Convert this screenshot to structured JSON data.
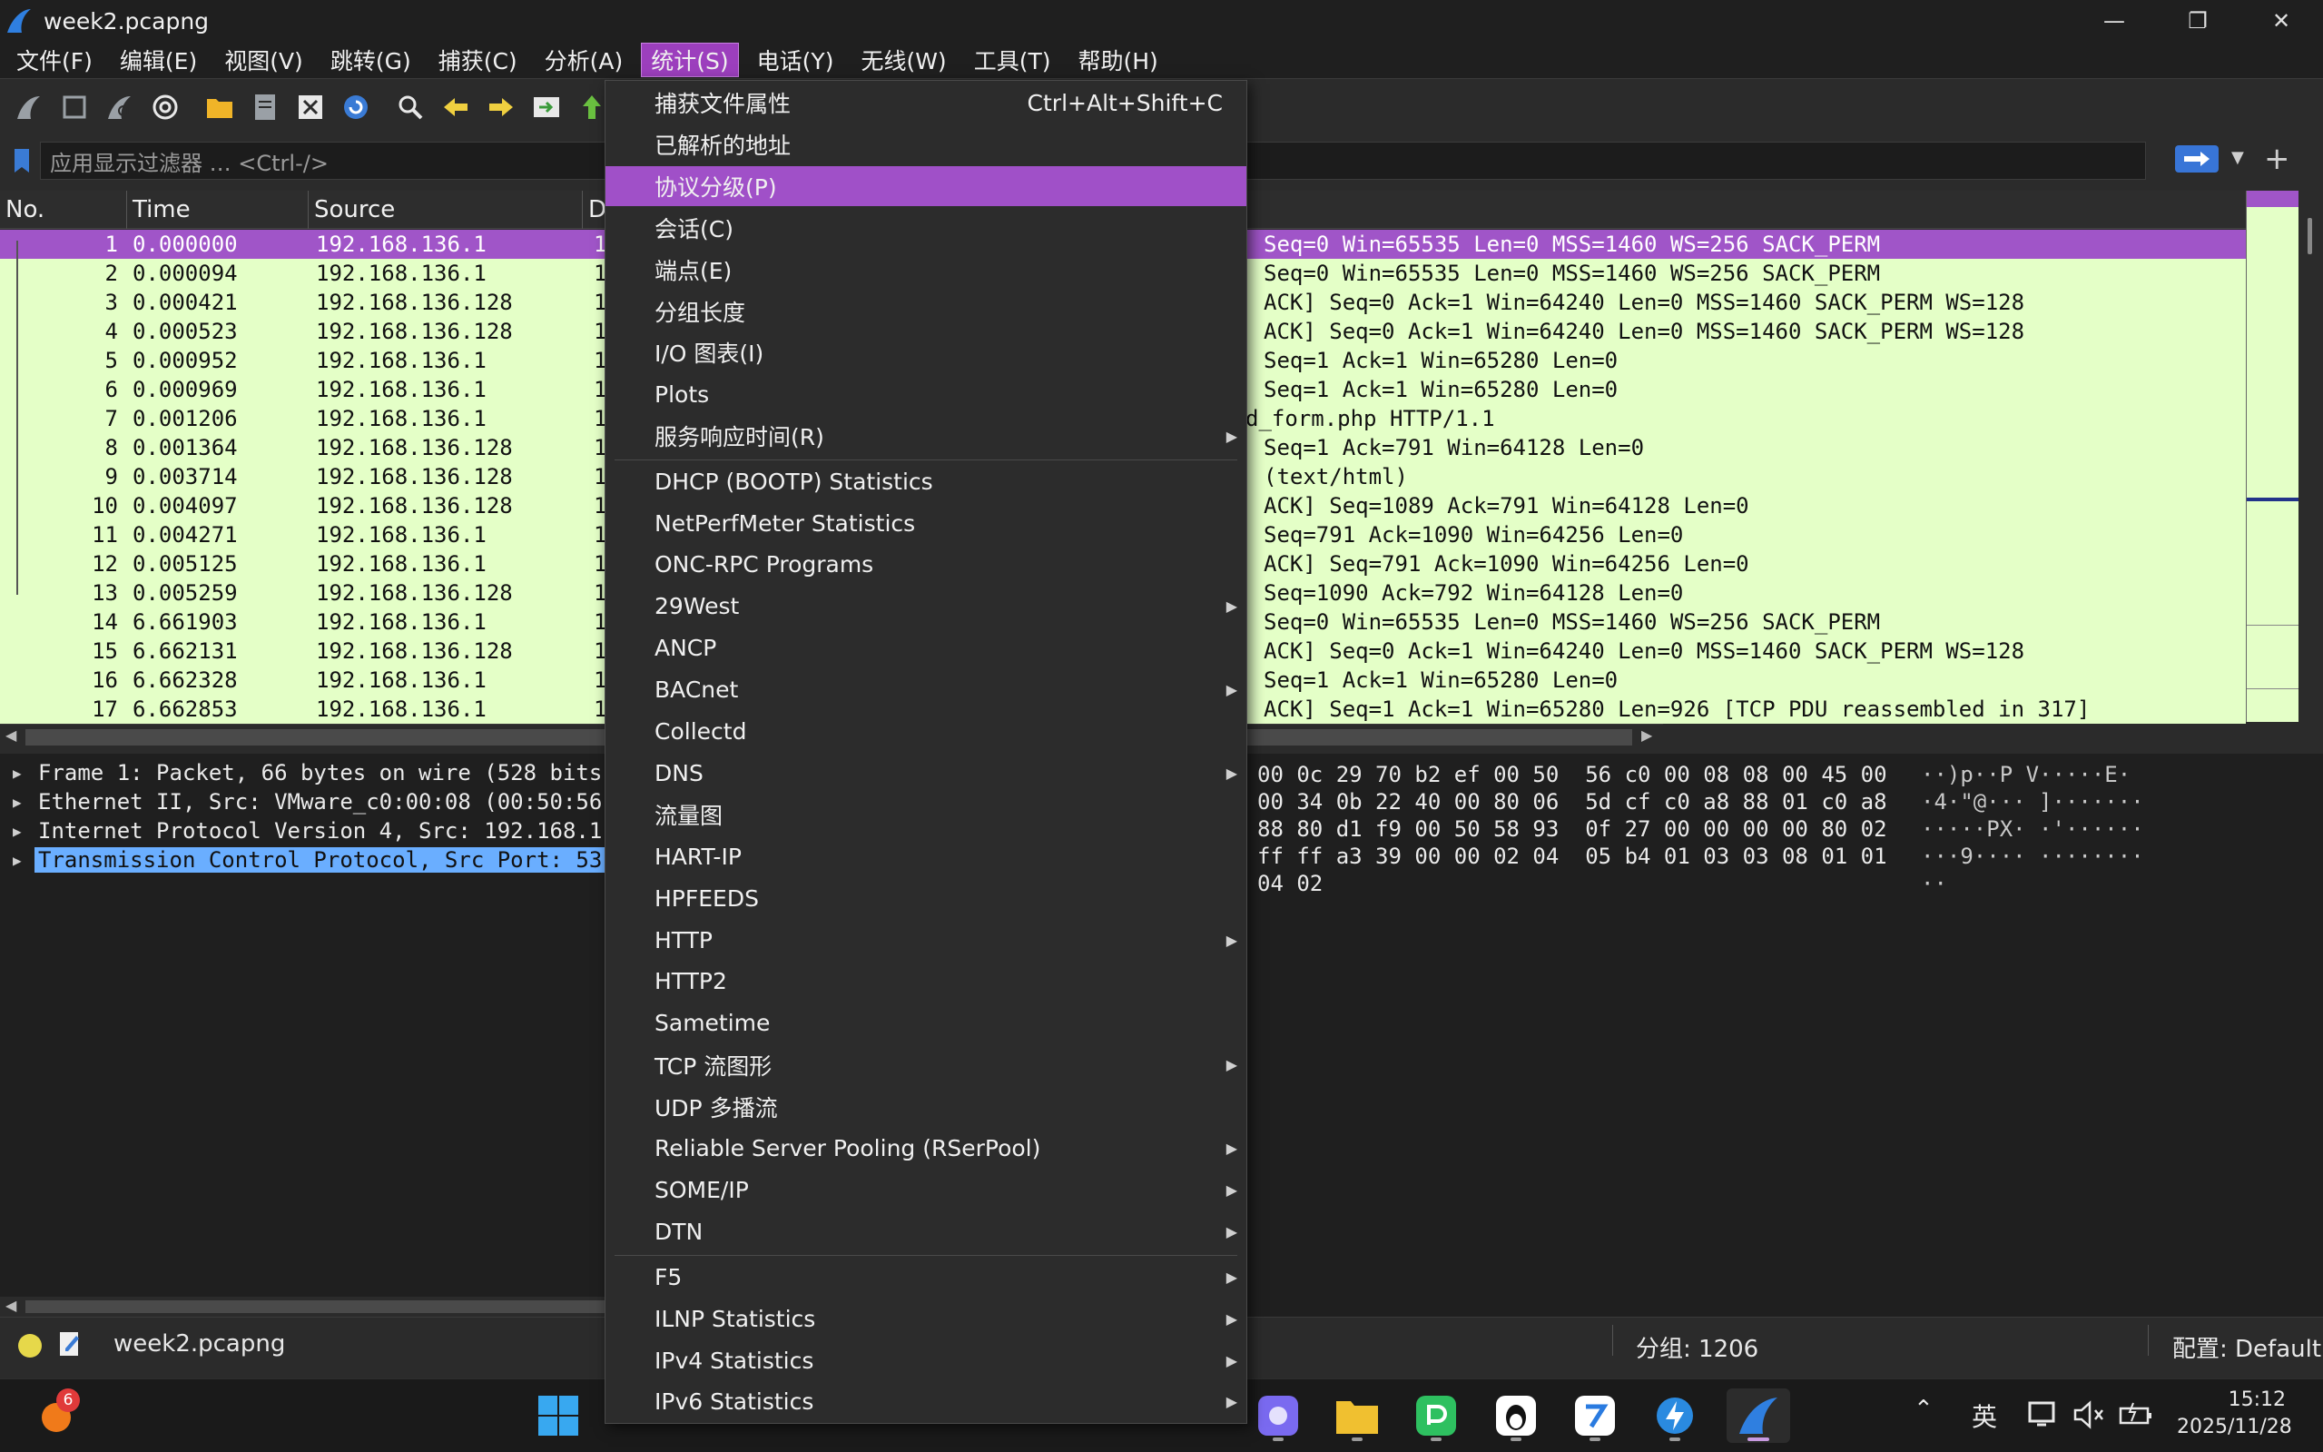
{
  "window": {
    "title": "week2.pcapng",
    "minimize": "—",
    "maximize": "❐",
    "close": "✕"
  },
  "menubar": [
    {
      "label": "文件(F)"
    },
    {
      "label": "编辑(E)"
    },
    {
      "label": "视图(V)"
    },
    {
      "label": "跳转(G)"
    },
    {
      "label": "捕获(C)"
    },
    {
      "label": "分析(A)"
    },
    {
      "label": "统计(S)",
      "active": true
    },
    {
      "label": "电话(Y)"
    },
    {
      "label": "无线(W)"
    },
    {
      "label": "工具(T)"
    },
    {
      "label": "帮助(H)"
    }
  ],
  "filter": {
    "placeholder": "应用显示过滤器 … <Ctrl-/>"
  },
  "packet_list": {
    "columns": [
      "No.",
      "Time",
      "Source",
      "D"
    ],
    "rows": [
      {
        "no": "1",
        "time": "0.000000",
        "src": "192.168.136.1",
        "dst": "1",
        "info": "Seq=0 Win=65535 Len=0 MSS=1460 WS=256 SACK_PERM",
        "selected": true
      },
      {
        "no": "2",
        "time": "0.000094",
        "src": "192.168.136.1",
        "dst": "1",
        "info": "Seq=0 Win=65535 Len=0 MSS=1460 WS=256 SACK_PERM"
      },
      {
        "no": "3",
        "time": "0.000421",
        "src": "192.168.136.128",
        "dst": "1",
        "info": "ACK] Seq=0 Ack=1 Win=64240 Len=0 MSS=1460 SACK_PERM WS=128"
      },
      {
        "no": "4",
        "time": "0.000523",
        "src": "192.168.136.128",
        "dst": "1",
        "info": "ACK] Seq=0 Ack=1 Win=64240 Len=0 MSS=1460 SACK_PERM WS=128"
      },
      {
        "no": "5",
        "time": "0.000952",
        "src": "192.168.136.1",
        "dst": "1",
        "info": "Seq=1 Ack=1 Win=65280 Len=0"
      },
      {
        "no": "6",
        "time": "0.000969",
        "src": "192.168.136.1",
        "dst": "1",
        "info": "Seq=1 Ack=1 Win=65280 Len=0"
      },
      {
        "no": "7",
        "time": "0.001206",
        "src": "192.168.136.1",
        "dst": "1",
        "info": "d_form.php HTTP/1.1",
        "info_offset": true
      },
      {
        "no": "8",
        "time": "0.001364",
        "src": "192.168.136.128",
        "dst": "1",
        "info": "Seq=1 Ack=791 Win=64128 Len=0"
      },
      {
        "no": "9",
        "time": "0.003714",
        "src": "192.168.136.128",
        "dst": "1",
        "info": "(text/html)"
      },
      {
        "no": "10",
        "time": "0.004097",
        "src": "192.168.136.128",
        "dst": "1",
        "info": "ACK] Seq=1089 Ack=791 Win=64128 Len=0"
      },
      {
        "no": "11",
        "time": "0.004271",
        "src": "192.168.136.1",
        "dst": "1",
        "info": "Seq=791 Ack=1090 Win=64256 Len=0"
      },
      {
        "no": "12",
        "time": "0.005125",
        "src": "192.168.136.1",
        "dst": "1",
        "info": "ACK] Seq=791 Ack=1090 Win=64256 Len=0"
      },
      {
        "no": "13",
        "time": "0.005259",
        "src": "192.168.136.128",
        "dst": "1",
        "info": "Seq=1090 Ack=792 Win=64128 Len=0"
      },
      {
        "no": "14",
        "time": "6.661903",
        "src": "192.168.136.1",
        "dst": "1",
        "info": "Seq=0 Win=65535 Len=0 MSS=1460 WS=256 SACK_PERM"
      },
      {
        "no": "15",
        "time": "6.662131",
        "src": "192.168.136.128",
        "dst": "1",
        "info": "ACK] Seq=0 Ack=1 Win=64240 Len=0 MSS=1460 SACK_PERM WS=128"
      },
      {
        "no": "16",
        "time": "6.662328",
        "src": "192.168.136.1",
        "dst": "1",
        "info": "Seq=1 Ack=1 Win=65280 Len=0"
      },
      {
        "no": "17",
        "time": "6.662853",
        "src": "192.168.136.1",
        "dst": "1",
        "info": "ACK] Seq=1 Ack=1 Win=65280 Len=926 [TCP PDU reassembled in 317]"
      }
    ]
  },
  "details": [
    {
      "text": "Frame 1: Packet, 66 bytes on wire (528 bits"
    },
    {
      "text": "Ethernet II, Src: VMware_c0:00:08 (00:50:56"
    },
    {
      "text": "Internet Protocol Version 4, Src: 192.168.1"
    },
    {
      "text": "Transmission Control Protocol, Src Port: 53",
      "highlighted": true
    }
  ],
  "bytes": [
    {
      "hex": "00 0c 29 70 b2 ef 00 50  56 c0 00 08 08 00 45 00",
      "ascii": "··)p··P V·····E·"
    },
    {
      "hex": "00 34 0b 22 40 00 80 06  5d cf c0 a8 88 01 c0 a8",
      "ascii": "·4·\"@··· ]·······"
    },
    {
      "hex": "88 80 d1 f9 00 50 58 93  0f 27 00 00 00 00 80 02",
      "ascii": "·····PX· ·'······"
    },
    {
      "hex": "ff ff a3 39 00 00 02 04  05 b4 01 03 03 08 01 01",
      "ascii": "···9···· ········"
    },
    {
      "hex": "04 02",
      "ascii": "··"
    }
  ],
  "statusbar": {
    "filename": "week2.pcapng",
    "packets": "分组: 1206",
    "profile": "配置: Default"
  },
  "stats_menu": {
    "items": [
      {
        "label": "捕获文件属性",
        "shortcut": "Ctrl+Alt+Shift+C"
      },
      {
        "label": "已解析的地址"
      },
      {
        "label": "协议分级(P)",
        "highlighted": true
      },
      {
        "label": "会话(C)"
      },
      {
        "label": "端点(E)"
      },
      {
        "label": "分组长度"
      },
      {
        "label": "I/O 图表(I)"
      },
      {
        "label": "Plots"
      },
      {
        "label": "服务响应时间(R)",
        "submenu": true,
        "sep_after": true
      },
      {
        "label": "DHCP (BOOTP) Statistics"
      },
      {
        "label": "NetPerfMeter Statistics"
      },
      {
        "label": "ONC-RPC Programs"
      },
      {
        "label": "29West",
        "submenu": true
      },
      {
        "label": "ANCP"
      },
      {
        "label": "BACnet",
        "submenu": true
      },
      {
        "label": "Collectd"
      },
      {
        "label": "DNS",
        "submenu": true
      },
      {
        "label": "流量图"
      },
      {
        "label": "HART-IP"
      },
      {
        "label": "HPFEEDS"
      },
      {
        "label": "HTTP",
        "submenu": true
      },
      {
        "label": "HTTP2"
      },
      {
        "label": "Sametime"
      },
      {
        "label": "TCP 流图形",
        "submenu": true
      },
      {
        "label": "UDP 多播流"
      },
      {
        "label": "Reliable Server Pooling (RSerPool)",
        "submenu": true
      },
      {
        "label": "SOME/IP",
        "submenu": true
      },
      {
        "label": "DTN",
        "submenu": true,
        "sep_after": true
      },
      {
        "label": "F5",
        "submenu": true
      },
      {
        "label": "ILNP Statistics",
        "submenu": true
      },
      {
        "label": "IPv4 Statistics",
        "submenu": true
      },
      {
        "label": "IPv6 Statistics",
        "submenu": true
      }
    ]
  },
  "taskbar": {
    "badge_count": "6",
    "ime": "英",
    "time": "15:12",
    "date": "2025/11/28"
  },
  "colors": {
    "accent": "#a050c8",
    "row_bg": "#e4ffc7",
    "detail_highlight": "#6aaeff"
  }
}
